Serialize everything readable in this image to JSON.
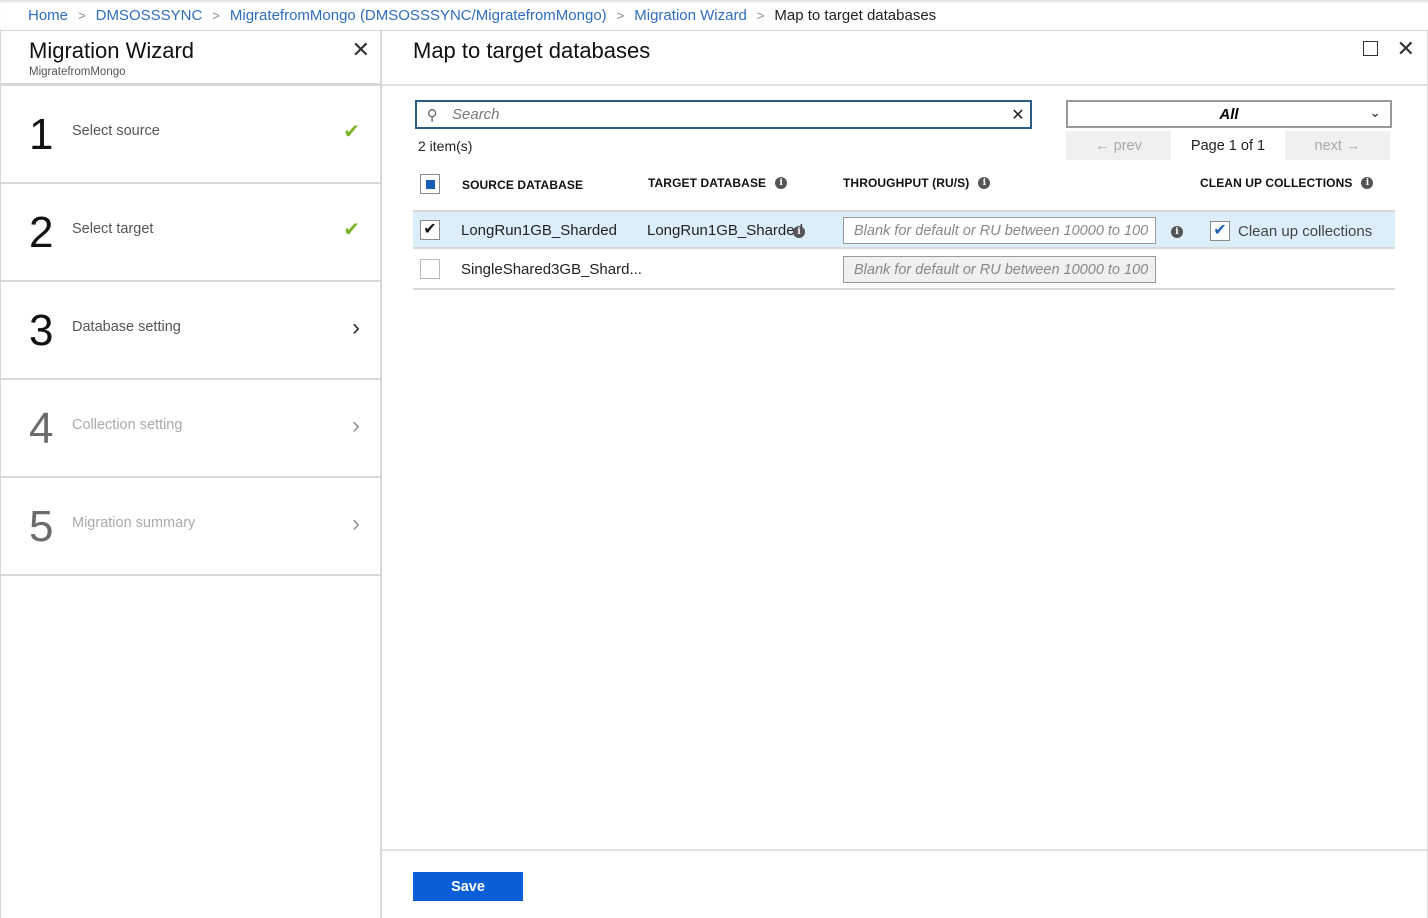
{
  "breadcrumb": {
    "items": [
      {
        "label": "Home"
      },
      {
        "label": "DMSOSSSYNC"
      },
      {
        "label": "MigratefromMongo (DMSOSSSYNC/MigratefromMongo)"
      },
      {
        "label": "Migration Wizard"
      }
    ],
    "current": "Map to target databases"
  },
  "wizard": {
    "title": "Migration Wizard",
    "subtitle": "MigratefromMongo",
    "close_icon": "✕",
    "steps": [
      {
        "number": "1",
        "label": "Select source",
        "status": "complete",
        "icon": "✔"
      },
      {
        "number": "2",
        "label": "Select target",
        "status": "complete",
        "icon": "✔"
      },
      {
        "number": "3",
        "label": "Database setting",
        "status": "current",
        "icon": "›"
      },
      {
        "number": "4",
        "label": "Collection setting",
        "status": "disabled",
        "icon": "›"
      },
      {
        "number": "5",
        "label": "Migration summary",
        "status": "disabled",
        "icon": "›"
      }
    ]
  },
  "panel": {
    "title": "Map to target databases",
    "close_icon": "✕",
    "search": {
      "placeholder": "Search",
      "value": "",
      "icon": "⚲",
      "clear_icon": "✕"
    },
    "filter": {
      "selected": "All",
      "chevron": "⌄"
    },
    "item_count": "2 item(s)",
    "pager": {
      "prev": "← prev",
      "info": "Page 1 of 1",
      "next": "next →"
    },
    "columns": {
      "source": "SOURCE DATABASE",
      "target": "TARGET DATABASE",
      "throughput": "THROUGHPUT (RU/S)",
      "cleanup": "CLEAN UP COLLECTIONS"
    },
    "info_glyph": "i",
    "rows": [
      {
        "selected": true,
        "source": "LongRun1GB_Sharded",
        "target": "LongRun1GB_Sharded",
        "throughput_placeholder": "Blank for default or RU between 10000 to 100",
        "cleanup_checked": true,
        "cleanup_label": "Clean up collections"
      },
      {
        "selected": false,
        "source": "SingleShared3GB_Shard...",
        "target": "",
        "throughput_placeholder": "Blank for default or RU between 10000 to 100"
      }
    ],
    "save_label": "Save"
  },
  "colors": {
    "link": "#2f6ebf",
    "primary_button": "#0a5fd8",
    "check_green": "#7ab42c",
    "selected_row": "#ddeefb"
  }
}
